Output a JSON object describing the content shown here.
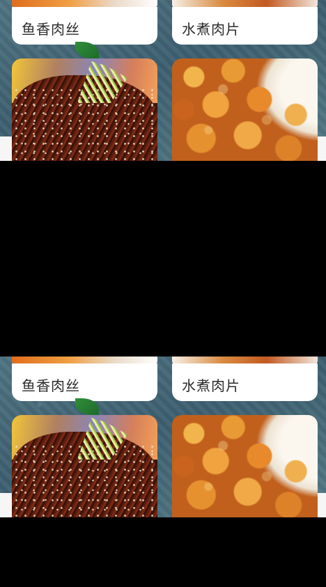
{
  "grid": {
    "items": [
      {
        "label": "鱼香肉丝"
      },
      {
        "label": "水煮肉片"
      }
    ]
  },
  "icons": {
    "leaf": "leaf-icon"
  },
  "colors": {
    "card_background": "#ffffff",
    "page_background": "#4f7382",
    "overlay": "#000000"
  }
}
